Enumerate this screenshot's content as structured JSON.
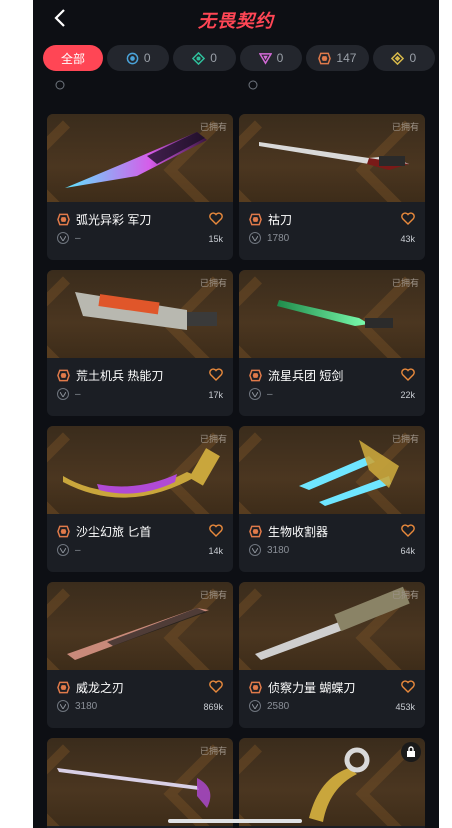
{
  "header": {
    "title": "无畏契约"
  },
  "filters": [
    {
      "label": "全部",
      "active": true
    },
    {
      "label": "0",
      "tier_color": "#4aa3d9"
    },
    {
      "label": "0",
      "tier_color": "#2fbf9b"
    },
    {
      "label": "0",
      "tier_color": "#d36ad6"
    },
    {
      "label": "147",
      "tier_color": "#e07a4a"
    },
    {
      "label": "0",
      "tier_color": "#d6b84a"
    }
  ],
  "cards": [
    {
      "name": "弧光异彩 军刀",
      "meta": "–",
      "likes": "15k",
      "owned": "已拥有"
    },
    {
      "name": "祜刀",
      "meta": "1780",
      "likes": "43k",
      "owned": "已拥有"
    },
    {
      "name": "荒土机兵 热能刀",
      "meta": "–",
      "likes": "17k",
      "owned": "已拥有"
    },
    {
      "name": "流星兵团 短剑",
      "meta": "–",
      "likes": "22k",
      "owned": "已拥有"
    },
    {
      "name": "沙尘幻旅 匕首",
      "meta": "–",
      "likes": "14k",
      "owned": "已拥有"
    },
    {
      "name": "生物收割器",
      "meta": "3180",
      "likes": "64k",
      "owned": "已拥有"
    },
    {
      "name": "威龙之刃",
      "meta": "3180",
      "likes": "869k",
      "owned": "已拥有"
    },
    {
      "name": "侦察力量 蝴蝶刀",
      "meta": "2580",
      "likes": "453k",
      "owned": "已拥有"
    },
    {
      "name": "",
      "meta": "",
      "likes": "",
      "owned": "已拥有"
    }
  ],
  "accent_color": "#ff4655",
  "heart_color": "#e8893c"
}
